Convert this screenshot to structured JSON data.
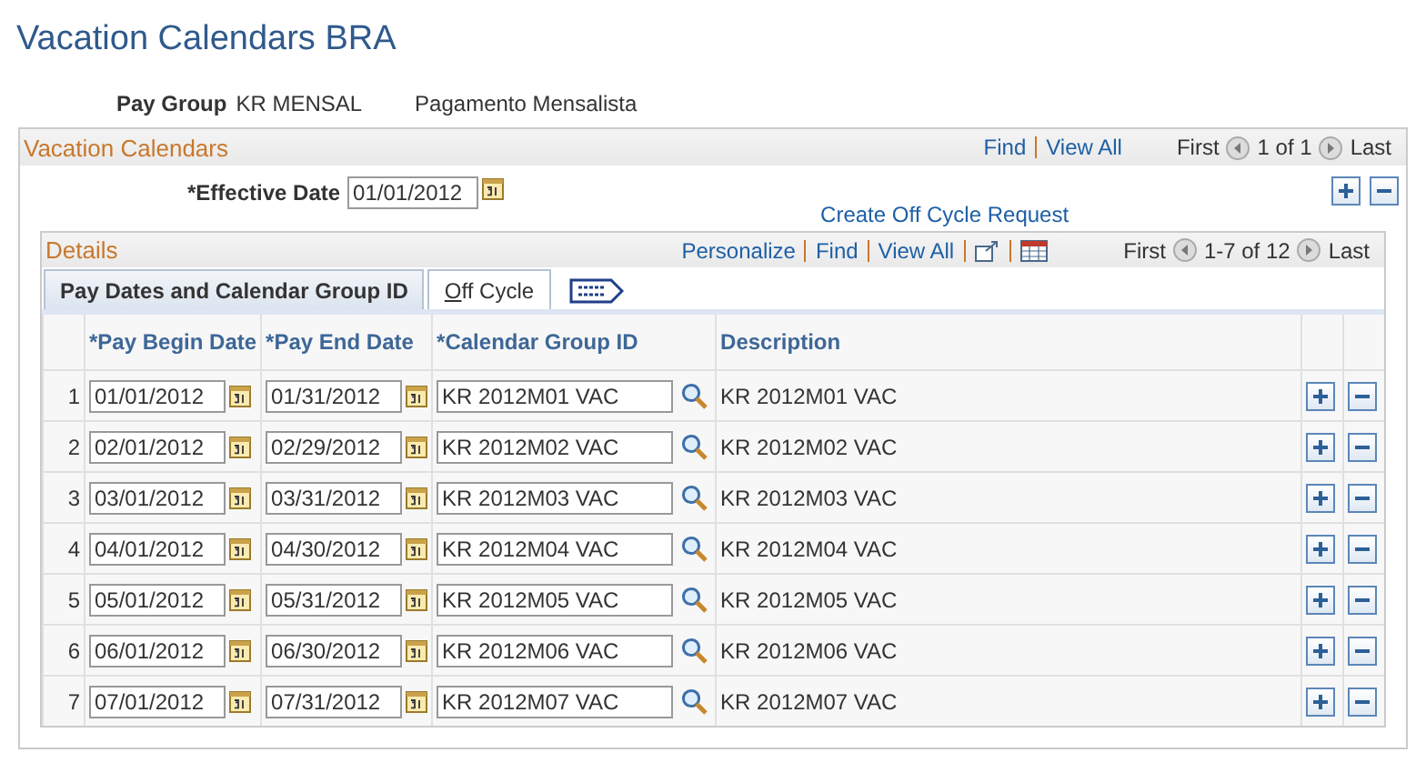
{
  "page_title": "Vacation Calendars BRA",
  "pay_group": {
    "label": "Pay Group",
    "code": "KR MENSAL",
    "description": "Pagamento Mensalista"
  },
  "vacation_calendars": {
    "title": "Vacation Calendars",
    "nav_links": [
      "Find",
      "View All"
    ],
    "first": "First",
    "count": "1 of 1",
    "last": "Last",
    "effective_date": {
      "label": "*Effective Date",
      "value": "01/01/2012"
    },
    "action_link": "Create Off Cycle Request"
  },
  "details": {
    "title": "Details",
    "nav_links": [
      "Personalize",
      "Find",
      "View All"
    ],
    "first": "First",
    "count": "1-7 of 12",
    "last": "Last",
    "tabs": [
      {
        "label": "Pay Dates and Calendar Group ID",
        "selected": true
      },
      {
        "label": "Off Cycle",
        "selected": false
      }
    ],
    "table": {
      "columns": [
        "*Pay Begin Date",
        "*Pay End Date",
        "*Calendar Group ID",
        "Description"
      ],
      "rows": [
        {
          "number": "1",
          "begin": "01/01/2012",
          "end": "01/31/2012",
          "group": "KR 2012M01 VAC",
          "description": "KR 2012M01 VAC"
        },
        {
          "number": "2",
          "begin": "02/01/2012",
          "end": "02/29/2012",
          "group": "KR 2012M02 VAC",
          "description": "KR 2012M02 VAC"
        },
        {
          "number": "3",
          "begin": "03/01/2012",
          "end": "03/31/2012",
          "group": "KR 2012M03 VAC",
          "description": "KR 2012M03 VAC"
        },
        {
          "number": "4",
          "begin": "04/01/2012",
          "end": "04/30/2012",
          "group": "KR 2012M04 VAC",
          "description": "KR 2012M04 VAC"
        },
        {
          "number": "5",
          "begin": "05/01/2012",
          "end": "05/31/2012",
          "group": "KR 2012M05 VAC",
          "description": "KR 2012M05 VAC"
        },
        {
          "number": "6",
          "begin": "06/01/2012",
          "end": "06/30/2012",
          "group": "KR 2012M06 VAC",
          "description": "KR 2012M06 VAC"
        },
        {
          "number": "7",
          "begin": "07/01/2012",
          "end": "07/31/2012",
          "group": "KR 2012M07 VAC",
          "description": "KR 2012M07 VAC"
        }
      ]
    }
  }
}
